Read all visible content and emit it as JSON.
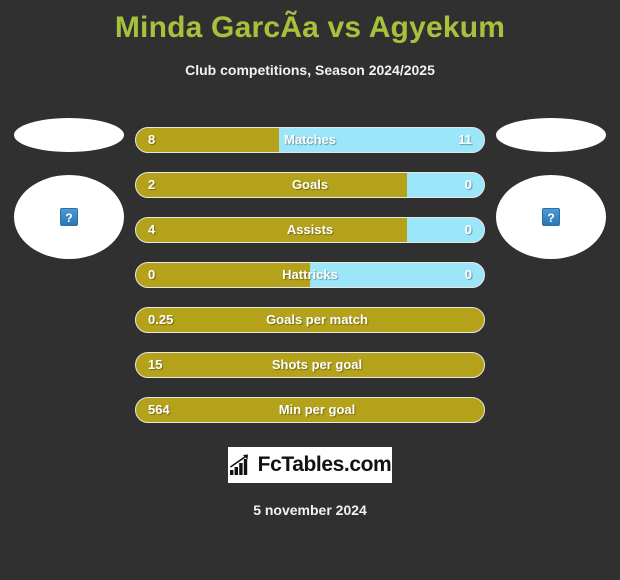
{
  "header": {
    "title": "Minda GarcÃ­a vs Agyekum",
    "subtitle": "Club competitions, Season 2024/2025",
    "title_color": "#a8c13c"
  },
  "players": {
    "left": {
      "photo_alt": "broken-image",
      "placeholder_glyph": "?"
    },
    "right": {
      "photo_alt": "broken-image",
      "placeholder_glyph": "?"
    }
  },
  "colors": {
    "background": "#303030",
    "bar_left": "#b5a21b",
    "bar_right": "#9ce6fa",
    "bar_border": "#e8e8e0",
    "text": "#ffffff"
  },
  "chart_data": {
    "type": "bar",
    "title": "Minda GarcÃ­a vs Agyekum",
    "subtitle": "Club competitions, Season 2024/2025",
    "orientation": "horizontal",
    "comparison": "two-player diverging bars",
    "legend": [
      "Minda GarcÃ­a",
      "Agyekum"
    ],
    "categories": [
      "Matches",
      "Goals",
      "Assists",
      "Hattricks",
      "Goals per match",
      "Shots per goal",
      "Min per goal"
    ],
    "series": [
      {
        "name": "left",
        "values": [
          "8",
          "2",
          "4",
          "0",
          "0.25",
          "15",
          "564"
        ]
      },
      {
        "name": "right",
        "values": [
          "11",
          "0",
          "0",
          "0",
          null,
          null,
          null
        ]
      }
    ],
    "rows": [
      {
        "label": "Matches",
        "left": "8",
        "right": "11",
        "fill_pct": 41,
        "dual": true
      },
      {
        "label": "Goals",
        "left": "2",
        "right": "0",
        "fill_pct": 78,
        "dual": true
      },
      {
        "label": "Assists",
        "left": "4",
        "right": "0",
        "fill_pct": 78,
        "dual": true
      },
      {
        "label": "Hattricks",
        "left": "0",
        "right": "0",
        "fill_pct": 50,
        "dual": true
      },
      {
        "label": "Goals per match",
        "left": "0.25",
        "right": "",
        "fill_pct": 100,
        "dual": false
      },
      {
        "label": "Shots per goal",
        "left": "15",
        "right": "",
        "fill_pct": 100,
        "dual": false
      },
      {
        "label": "Min per goal",
        "left": "564",
        "right": "",
        "fill_pct": 100,
        "dual": false
      }
    ]
  },
  "footer": {
    "logo_text": "FcTables.com",
    "logo_icon": "bar-chart-icon",
    "date": "5 november 2024"
  }
}
